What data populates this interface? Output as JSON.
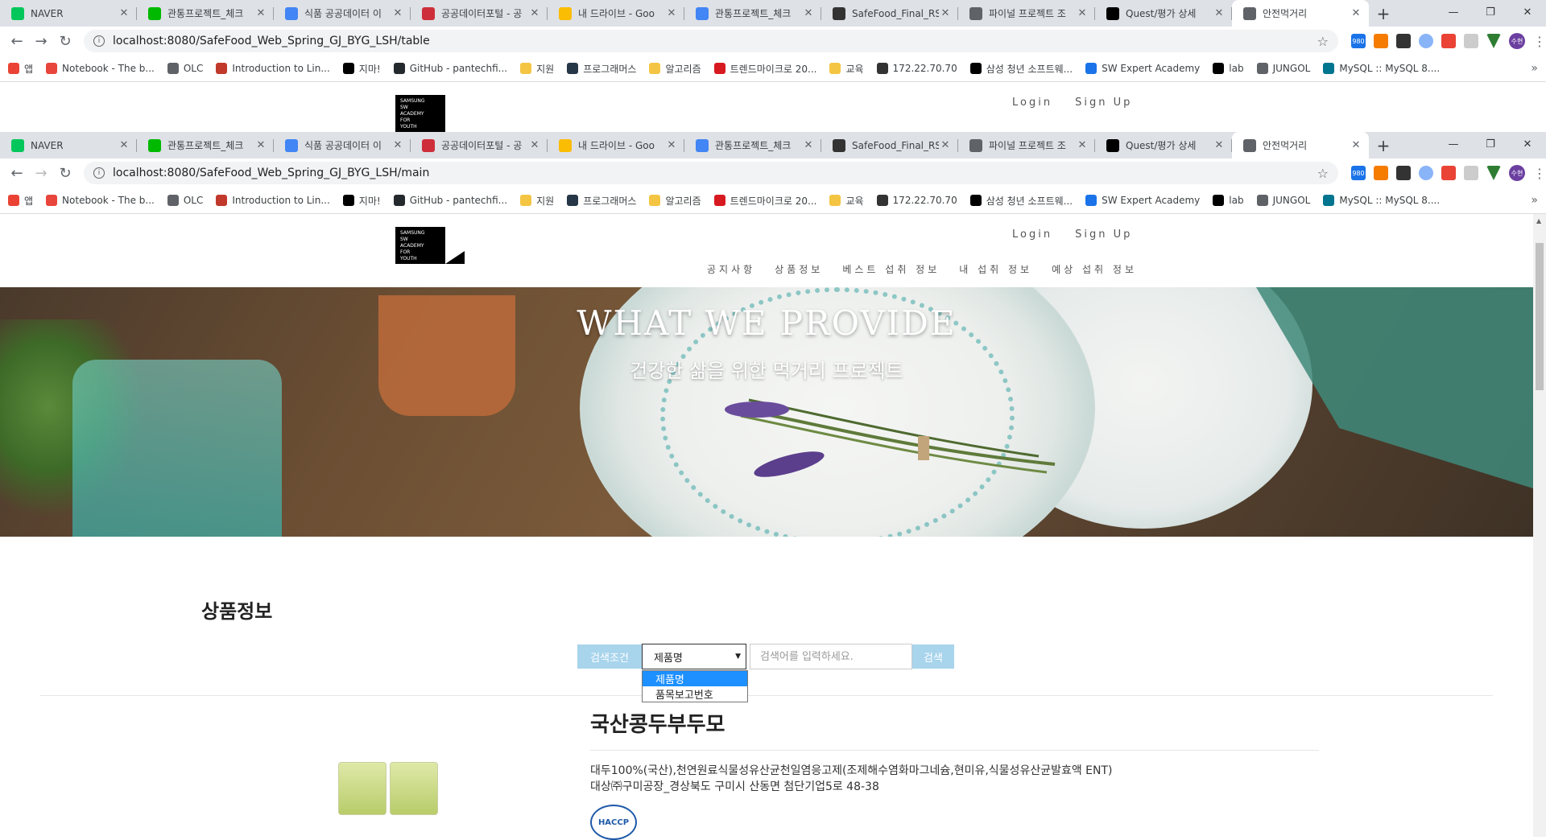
{
  "browser": {
    "tabs": [
      {
        "title": "NAVER",
        "favicon": "naver-icon",
        "color": "#03c75a"
      },
      {
        "title": "관통프로젝트_체크",
        "favicon": "line-icon",
        "color": "#00b900"
      },
      {
        "title": "식품 공공데이터 이",
        "favicon": "google-icon",
        "color": "#4285f4"
      },
      {
        "title": "공공데이터포털 - 공",
        "favicon": "korea-icon",
        "color": "#cd2e3a"
      },
      {
        "title": "내 드라이브 - Goo",
        "favicon": "drive-icon",
        "color": "#fbbc04"
      },
      {
        "title": "관통프로젝트_체크",
        "favicon": "docs-icon",
        "color": "#4285f4"
      },
      {
        "title": "SafeFood_Final_RSI",
        "favicon": "ms-icon",
        "color": "#333333"
      },
      {
        "title": "파이널 프로젝트 조",
        "favicon": "globe-icon",
        "color": "#5f6368"
      },
      {
        "title": "Quest/평가 상세",
        "favicon": "swea-icon",
        "color": "#000000"
      },
      {
        "title": "안전먹거리",
        "favicon": "globe-icon",
        "color": "#5f6368"
      }
    ],
    "url_top": "localhost:8080/SafeFood_Web_Spring_GJ_BYG_LSH/table",
    "url_main": "localhost:8080/SafeFood_Web_Spring_GJ_BYG_LSH/main",
    "ext_badge": "980",
    "avatar_text": "수현",
    "bookmarks": [
      {
        "label": "앱",
        "color": "#ea4335"
      },
      {
        "label": "Notebook - The b...",
        "color": "#e8453c"
      },
      {
        "label": "OLC",
        "color": "#5f6368"
      },
      {
        "label": "Introduction to Lin...",
        "color": "#c0392b"
      },
      {
        "label": "지마!",
        "color": "#000000"
      },
      {
        "label": "GitHub - pantechfi...",
        "color": "#24292e"
      },
      {
        "label": "지원",
        "color": "#f4c542"
      },
      {
        "label": "프로그래머스",
        "color": "#263747"
      },
      {
        "label": "알고리즘",
        "color": "#f4c542"
      },
      {
        "label": "트렌드마이크로 20...",
        "color": "#d71920"
      },
      {
        "label": "교육",
        "color": "#f4c542"
      },
      {
        "label": "172.22.70.70",
        "color": "#333333"
      },
      {
        "label": "삼성 청년 소프트웨...",
        "color": "#000000"
      },
      {
        "label": "SW Expert Academy",
        "color": "#1a73e8"
      },
      {
        "label": "lab",
        "color": "#000000"
      },
      {
        "label": "JUNGOL",
        "color": "#5f6368"
      },
      {
        "label": "MySQL :: MySQL 8....",
        "color": "#00758f"
      }
    ]
  },
  "site": {
    "logo_lines": [
      "SAMSUNG",
      "SW",
      "ACADEMY",
      "FOR",
      "YOUTH"
    ],
    "login": "Login",
    "signup": "Sign Up",
    "nav": [
      "공지사항",
      "상품정보",
      "베스트 섭취 정보",
      "내 섭취 정보",
      "예상 섭취 정보"
    ],
    "hero_title": "WHAT WE PROVIDE",
    "hero_subtitle": "건강한 삶을 위한 먹거리 프로젝트",
    "section_title": "상품정보"
  },
  "search": {
    "label": "검색조건",
    "selected": "제품명",
    "placeholder": "검색어를 입력하세요.",
    "button": "검색",
    "options": [
      "제품명",
      "품목보고번호"
    ]
  },
  "product": {
    "name": "국산콩두부두모",
    "ingredients": "대두100%(국산),천연원료식물성유산균천일염응고제(조제해수염화마그네슘,현미유,식물성유산균발효액 ENT)",
    "maker": "대상㈜구미공장_경상북도 구미시 산동면 첨단기업5로 48-38",
    "badge": "HACCP"
  }
}
